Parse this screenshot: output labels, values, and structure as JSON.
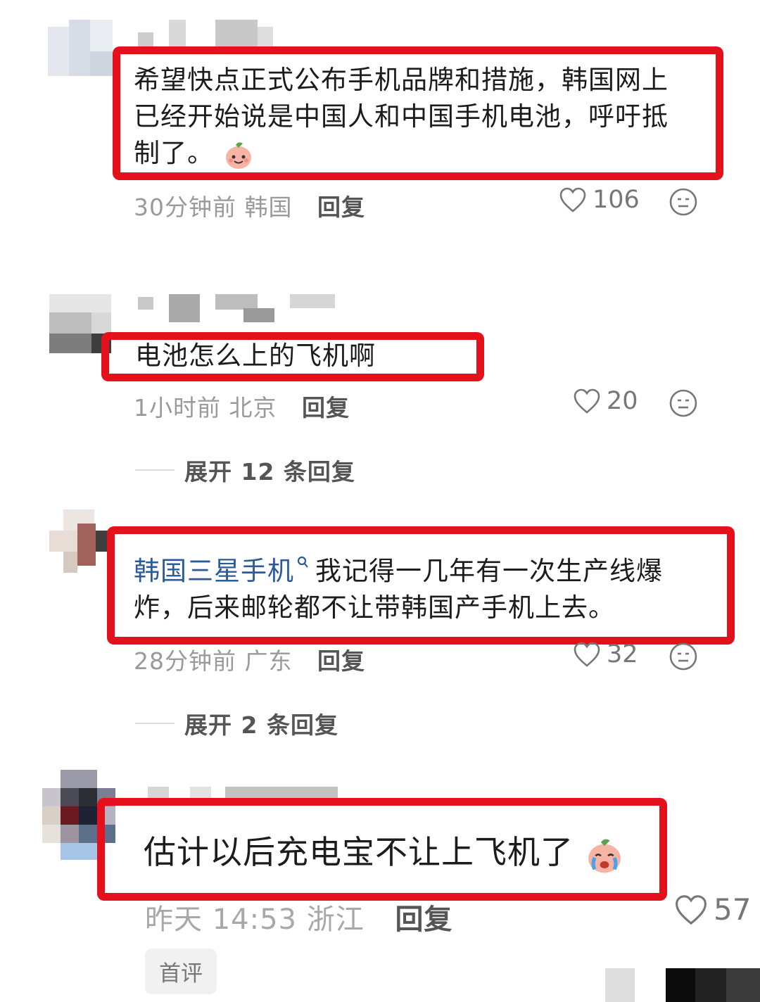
{
  "comments": [
    {
      "text": "希望快点正式公布手机品牌和措施，韩国网上已经开始说是中国人和中国手机电池，呼吁抵制了。",
      "line1": "希望快点正式公布手机品牌和措施，韩国网上",
      "line2": "已经开始说是中国人和中国手机电池，呼吁抵",
      "line3": "制了。",
      "time": "30分钟前",
      "location": "韩国",
      "reply_label": "回复",
      "likes": "106",
      "emoji": "happy-peach-emoji"
    },
    {
      "text": "电池怎么上的飞机啊",
      "time": "1小时前",
      "location": "北京",
      "reply_label": "回复",
      "likes": "20",
      "expand_label": "展开 12 条回复"
    },
    {
      "link_text": "韩国三星手机",
      "line1_rest": "我记得一几年有一次生产线爆",
      "line2": "炸，后来邮轮都不让带韩国产手机上去。",
      "time": "28分钟前",
      "location": "广东",
      "reply_label": "回复",
      "likes": "32",
      "expand_label": "展开 2 条回复"
    },
    {
      "text": "估计以后充电宝不让上飞机了",
      "time": "昨天 14:53",
      "location": "浙江",
      "reply_label": "回复",
      "likes": "57",
      "badge": "首评",
      "emoji": "crying-peach-emoji"
    }
  ],
  "colors": {
    "highlight_box": "#e4101c",
    "link": "#2c5b9a",
    "meta_text": "#9a9a9a"
  }
}
